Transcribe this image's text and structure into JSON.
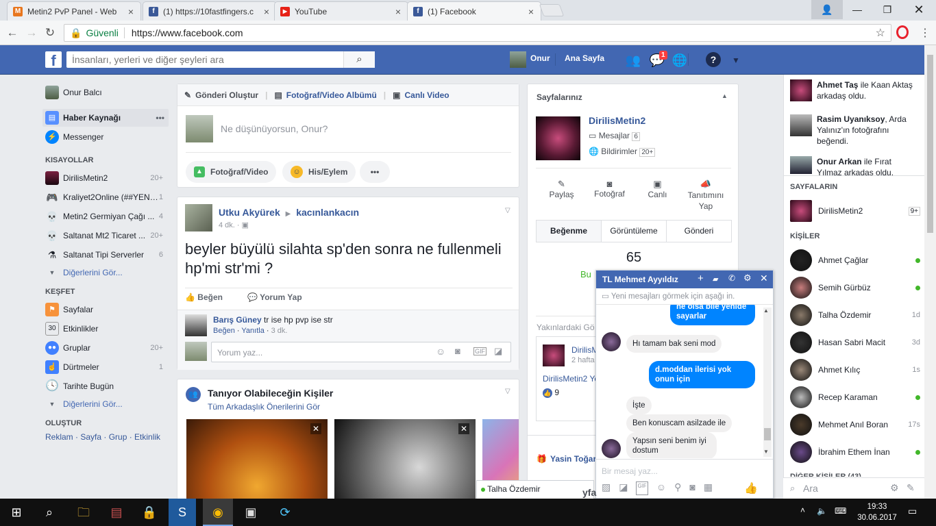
{
  "tabs": [
    {
      "title": "Metin2 PvP Panel - Web",
      "fav": "M",
      "color": "#e8761e"
    },
    {
      "title": "(1) https://10fastfingers.c",
      "fav": "f",
      "color": "#3b5998"
    },
    {
      "title": "YouTube",
      "fav": "▶",
      "color": "#e62117"
    },
    {
      "title": "(1) Facebook",
      "fav": "f",
      "color": "#3b5998"
    }
  ],
  "address": {
    "secure_label": "Güvenli",
    "url": "https://www.facebook.com"
  },
  "header": {
    "search_placeholder": "İnsanları, yerleri ve diğer şeyleri ara",
    "user_name": "Onur",
    "home": "Ana Sayfa",
    "messages_badge": "1"
  },
  "left": {
    "profile": "Onur Balcı",
    "main": [
      {
        "label": "Haber Kaynağı"
      },
      {
        "label": "Messenger"
      }
    ],
    "shortcuts_title": "KISAYOLLAR",
    "shortcuts": [
      {
        "label": "DirilisMetin2",
        "count": "20+"
      },
      {
        "label": "Kraliyet2Online (##YENİ...",
        "count": "1"
      },
      {
        "label": "Metin2 Germiyan Çağı ...",
        "count": "4"
      },
      {
        "label": "Saltanat Mt2 Ticaret ...",
        "count": "20+"
      },
      {
        "label": "Saltanat Tipi Serverler",
        "count": "6"
      }
    ],
    "see_more": "Diğerlerini Gör...",
    "explore_title": "KEŞFET",
    "explore": [
      {
        "label": "Sayfalar",
        "count": ""
      },
      {
        "label": "Etkinlikler",
        "count": ""
      },
      {
        "label": "Gruplar",
        "count": "20+"
      },
      {
        "label": "Dürtmeler",
        "count": "1"
      },
      {
        "label": "Tarihte Bugün",
        "count": ""
      }
    ],
    "create_title": "OLUŞTUR",
    "create_links": "Reklam · Sayfa · Grup · Etkinlik",
    "calendar_day": "30"
  },
  "composer": {
    "tab1": "Gönderi Oluştur",
    "tab2": "Fotoğraf/Video Albümü",
    "tab3": "Canlı Video",
    "placeholder": "Ne düşünüyorsun, Onur?",
    "btn_photo": "Fotoğraf/Video",
    "btn_feeling": "His/Eylem"
  },
  "post": {
    "author": "Utku Akyürek",
    "target": "kacınlankacın",
    "time": "4 dk.",
    "text": "beyler büyülü silahta sp'den sonra ne fullenmeli hp'mi str'mi ?",
    "like": "Beğen",
    "comment": "Yorum Yap",
    "c_author": "Barış Güney",
    "c_text": "tr ise hp pvp ise str",
    "c_like": "Beğen",
    "c_reply": "Yanıtla",
    "c_time": "3 dk.",
    "write_placeholder": "Yorum yaz..."
  },
  "pymk": {
    "title": "Tanıyor Olabileceğin Kişiler",
    "sub": "Tüm Arkadaşlık Önerilerini Gör"
  },
  "pages": {
    "title": "Sayfalarınız",
    "name": "DirilisMetin2",
    "messages": "Mesajlar",
    "messages_count": "6",
    "notifications": "Bildirimler",
    "notifications_count": "20+",
    "actions": [
      "Paylaş",
      "Fotoğraf",
      "Canlı",
      "Tanıtımını Yap"
    ],
    "tabs": [
      "Beğenme",
      "Görüntüleme",
      "Gönderi"
    ],
    "likes": "65",
    "recent_title": "Yakınlardaki Gö",
    "recent_name": "DirilisM",
    "recent_time": "2 hafta",
    "recent_link": "DirilisMetin2 Ye",
    "recent_likes": "9",
    "bottom_name": "Yasin Toğar"
  },
  "ticker": [
    {
      "bold": "Ahmet Taş",
      "rest": " ile Kaan Aktaş arkadaş oldu."
    },
    {
      "bold": "Rasim Uyanıksoy",
      "rest": ", Arda Yalınız'ın fotoğrafını beğendi."
    },
    {
      "bold": "Onur Arkan",
      "rest": " ile Fırat Yılmaz arkadaş oldu."
    }
  ],
  "chat": {
    "pages_title": "SAYFALARIN",
    "page": "DirilisMetin2",
    "page_badge": "9+",
    "people_title": "KİŞİLER",
    "people": [
      {
        "name": "Ahmet Çağlar",
        "status": "",
        "online": true
      },
      {
        "name": "Semih Gürbüz",
        "status": "",
        "online": true
      },
      {
        "name": "Talha Özdemir",
        "status": "1d",
        "online": false
      },
      {
        "name": "Hasan Sabri Macit",
        "status": "3d",
        "online": false
      },
      {
        "name": "Ahmet Kılıç",
        "status": "1s",
        "online": false
      },
      {
        "name": "Recep Karaman",
        "status": "",
        "online": true
      },
      {
        "name": "Mehmet Anıl Boran",
        "status": "17s",
        "online": false
      },
      {
        "name": "İbrahim Ethem İnan",
        "status": "",
        "online": true
      }
    ],
    "other_title": "DİĞER KİŞİLER (43)",
    "search": "Ara"
  },
  "messenger": {
    "title": "TL Mehmet Ayyıldız",
    "notice": "Yeni mesajları görmek için aşağı in.",
    "m1": "ne olsa bile yenide sayarlar",
    "m2": "Hı tamam bak seni mod",
    "m3": "d.moddan ilerisi yok onun için",
    "m4": "İşte",
    "m5": "Ben konuscam asilzade ile",
    "m6": "Yapsın seni benim iyi dostum",
    "input": "Bir mesaj yaz...",
    "float_name": "Talha Özdemir"
  },
  "taskbar": {
    "time": "19:33",
    "date": "30.06.2017"
  }
}
